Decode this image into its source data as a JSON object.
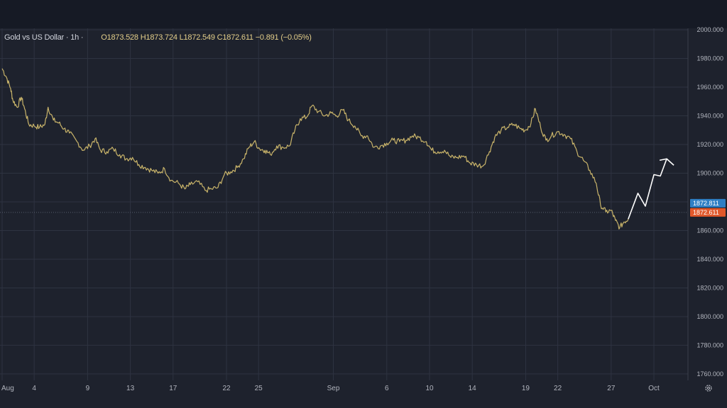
{
  "header": {
    "symbol": "Gold vs US Dollar · 1h ·",
    "ohlc": "O1873.528 H1873.724 L1872.549 C1872.611 −0.891 (−0.05%)"
  },
  "price_tags": {
    "upper": "1872.811",
    "lower": "1872.611",
    "upper_color": "#2e7fc4",
    "lower_color": "#e0582b"
  },
  "colors": {
    "price_line": "#c9b46a",
    "projection": "#ffffff",
    "grid": "#2e3341"
  },
  "icons": {
    "settings": "gear-icon"
  },
  "chart_data": {
    "type": "line",
    "y_axis_side": "right",
    "ylim": [
      1757,
      2001
    ],
    "y_ticks": [
      "2000.000",
      "1980.000",
      "1960.000",
      "1940.000",
      "1920.000",
      "1900.000",
      "1880.000",
      "1860.000",
      "1840.000",
      "1820.000",
      "1800.000",
      "1780.000",
      "1760.000"
    ],
    "x_ticks": [
      {
        "label": "Aug",
        "day": 1
      },
      {
        "label": "4",
        "day": 4
      },
      {
        "label": "9",
        "day": 9
      },
      {
        "label": "13",
        "day": 13
      },
      {
        "label": "17",
        "day": 17
      },
      {
        "label": "22",
        "day": 22
      },
      {
        "label": "25",
        "day": 25
      },
      {
        "label": "Sep",
        "day": 32
      },
      {
        "label": "6",
        "day": 37
      },
      {
        "label": "10",
        "day": 41
      },
      {
        "label": "14",
        "day": 45
      },
      {
        "label": "19",
        "day": 50
      },
      {
        "label": "22",
        "day": 53
      },
      {
        "label": "27",
        "day": 58
      },
      {
        "label": "Oct",
        "day": 62
      }
    ],
    "xlim": [
      0.9,
      64.5
    ],
    "series": [
      {
        "type": "price",
        "points": [
          [
            1.0,
            1973
          ],
          [
            1.4,
            1967
          ],
          [
            1.8,
            1959
          ],
          [
            2.0,
            1951
          ],
          [
            2.4,
            1946
          ],
          [
            2.8,
            1953
          ],
          [
            3.1,
            1945
          ],
          [
            3.5,
            1934
          ],
          [
            4.0,
            1933
          ],
          [
            4.5,
            1932
          ],
          [
            5.0,
            1934
          ],
          [
            5.3,
            1946
          ],
          [
            5.8,
            1937
          ],
          [
            6.3,
            1935
          ],
          [
            6.8,
            1931
          ],
          [
            7.3,
            1928
          ],
          [
            8.0,
            1922
          ],
          [
            8.6,
            1916
          ],
          [
            9.2,
            1919
          ],
          [
            9.7,
            1924
          ],
          [
            10.2,
            1916
          ],
          [
            10.8,
            1915
          ],
          [
            11.4,
            1917
          ],
          [
            12.0,
            1913
          ],
          [
            12.6,
            1910
          ],
          [
            13.2,
            1911
          ],
          [
            13.8,
            1906
          ],
          [
            14.4,
            1904
          ],
          [
            15.0,
            1902
          ],
          [
            15.6,
            1900
          ],
          [
            16.2,
            1903
          ],
          [
            16.8,
            1895
          ],
          [
            17.5,
            1893
          ],
          [
            18.1,
            1889
          ],
          [
            18.6,
            1892
          ],
          [
            19.3,
            1894
          ],
          [
            20.0,
            1888
          ],
          [
            20.6,
            1889
          ],
          [
            21.2,
            1890
          ],
          [
            21.8,
            1899
          ],
          [
            22.4,
            1901
          ],
          [
            23.0,
            1904
          ],
          [
            23.6,
            1910
          ],
          [
            24.1,
            1918
          ],
          [
            24.6,
            1922
          ],
          [
            25.1,
            1917
          ],
          [
            25.6,
            1916
          ],
          [
            26.1,
            1913
          ],
          [
            26.7,
            1919
          ],
          [
            27.3,
            1918
          ],
          [
            27.9,
            1919
          ],
          [
            28.4,
            1930
          ],
          [
            28.9,
            1938
          ],
          [
            29.5,
            1939
          ],
          [
            30.0,
            1947
          ],
          [
            30.6,
            1943
          ],
          [
            31.2,
            1940
          ],
          [
            31.8,
            1942
          ],
          [
            32.3,
            1940
          ],
          [
            32.9,
            1944
          ],
          [
            33.4,
            1937
          ],
          [
            34.0,
            1933
          ],
          [
            34.6,
            1926
          ],
          [
            35.2,
            1926
          ],
          [
            35.8,
            1918
          ],
          [
            36.4,
            1919
          ],
          [
            37.0,
            1921
          ],
          [
            37.6,
            1923
          ],
          [
            38.2,
            1922
          ],
          [
            38.8,
            1923
          ],
          [
            39.4,
            1926
          ],
          [
            40.0,
            1925
          ],
          [
            40.7,
            1922
          ],
          [
            41.2,
            1916
          ],
          [
            41.8,
            1915
          ],
          [
            42.4,
            1916
          ],
          [
            43.0,
            1911
          ],
          [
            43.6,
            1911
          ],
          [
            44.2,
            1912
          ],
          [
            44.8,
            1907
          ],
          [
            45.4,
            1906
          ],
          [
            46.0,
            1905
          ],
          [
            46.6,
            1915
          ],
          [
            47.1,
            1925
          ],
          [
            47.7,
            1930
          ],
          [
            48.3,
            1932
          ],
          [
            48.9,
            1934
          ],
          [
            49.5,
            1931
          ],
          [
            50.0,
            1930
          ],
          [
            50.5,
            1935
          ],
          [
            50.9,
            1945
          ],
          [
            51.4,
            1932
          ],
          [
            51.9,
            1923
          ],
          [
            52.4,
            1926
          ],
          [
            53.0,
            1929
          ],
          [
            53.6,
            1927
          ],
          [
            54.2,
            1924
          ],
          [
            54.8,
            1915
          ],
          [
            55.4,
            1909
          ],
          [
            56.0,
            1902
          ],
          [
            56.6,
            1893
          ],
          [
            57.0,
            1878
          ],
          [
            57.5,
            1873
          ],
          [
            58.0,
            1874
          ],
          [
            58.4,
            1867
          ],
          [
            58.8,
            1862
          ],
          [
            59.2,
            1866
          ],
          [
            59.6,
            1868
          ]
        ]
      },
      {
        "type": "projection",
        "points": [
          [
            59.6,
            1868
          ],
          [
            60.5,
            1886
          ],
          [
            61.2,
            1877
          ],
          [
            62.0,
            1899
          ],
          [
            62.6,
            1898
          ],
          [
            63.2,
            1910
          ]
        ]
      }
    ],
    "current_price": 1872.611
  }
}
